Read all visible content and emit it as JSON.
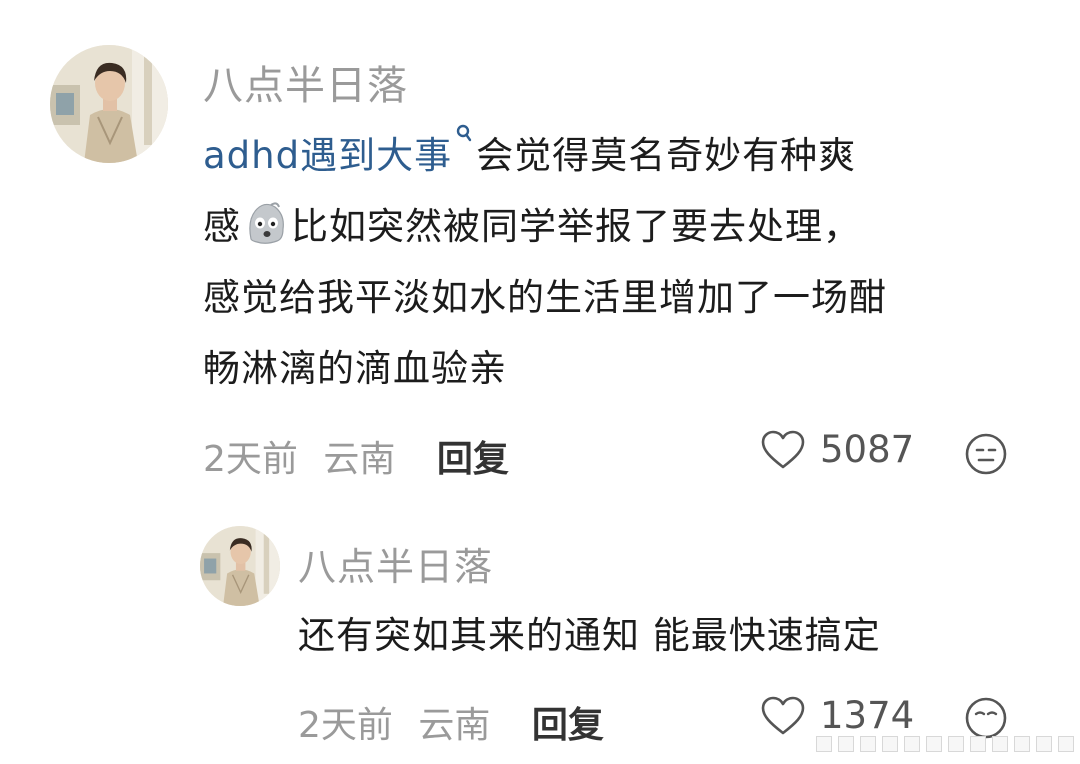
{
  "comments": [
    {
      "username": "八点半日落",
      "topic_tag": "adhd遇到大事",
      "text_line1_rest": "会觉得莫名奇妙有种爽",
      "text_line2_prefix": "感",
      "emoji": "ghost-face-emoji",
      "text_line2_rest": "比如突然被同学举报了要去处理，",
      "text_line3": "感觉给我平淡如水的生活里增加了一场酣",
      "text_line4": "畅淋漓的滴血验亲",
      "time": "2天前",
      "location": "云南",
      "reply_label": "回复",
      "likes": "5087"
    },
    {
      "username": "八点半日落",
      "text": "还有突如其来的通知 能最快速搞定",
      "time": "2天前",
      "location": "云南",
      "reply_label": "回复",
      "likes": "1374"
    }
  ],
  "colors": {
    "username": "#9a9a9a",
    "topic": "#2e5d8f",
    "text": "#1c1c1c",
    "meta": "#9a9a9a"
  },
  "icons": [
    "search-topic-icon",
    "heart-icon",
    "face-reaction-icon",
    "avatar-portrait"
  ]
}
